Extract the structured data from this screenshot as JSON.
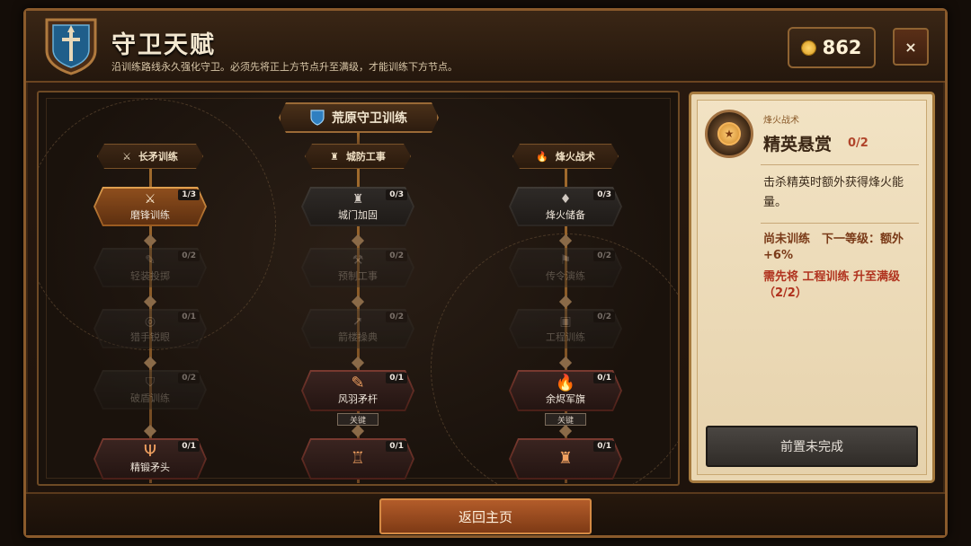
{
  "header": {
    "title": "守卫天赋",
    "subtitle": "沿训练路线永久强化守卫。必须先将正上方节点升至满级，才能训练下方节点。",
    "gold": "862",
    "close_label": "×"
  },
  "tree": {
    "title": "荒原守卫训练",
    "columns": [
      {
        "name": "长矛训练",
        "icon": "crossed-swords-icon",
        "nodes": [
          {
            "label": "磨锋训练",
            "count": "1/3",
            "icon": "crossed-swords-icon",
            "state": "active"
          },
          {
            "label": "轻装投掷",
            "count": "0/2",
            "icon": "feather-icon",
            "state": "locked"
          },
          {
            "label": "猎手锐眼",
            "count": "0/1",
            "icon": "target-icon",
            "state": "locked"
          },
          {
            "label": "破盾训练",
            "count": "0/2",
            "icon": "shield-icon",
            "state": "locked"
          },
          {
            "label": "精锻矛头",
            "count": "0/1",
            "icon": "trident-icon",
            "state": "key"
          }
        ]
      },
      {
        "name": "城防工事",
        "icon": "castle-icon",
        "nodes": [
          {
            "label": "城门加固",
            "count": "0/3",
            "icon": "castle-icon",
            "state": "available"
          },
          {
            "label": "预制工事",
            "count": "0/2",
            "icon": "hammer-icon",
            "state": "locked"
          },
          {
            "label": "箭楼操典",
            "count": "0/2",
            "icon": "arrow-icon",
            "state": "locked"
          },
          {
            "label": "风羽矛杆",
            "count": "0/1",
            "icon": "feather-icon",
            "state": "key",
            "tag": "关键"
          },
          {
            "label": "",
            "count": "0/1",
            "icon": "tower-icon",
            "state": "key"
          }
        ]
      },
      {
        "name": "烽火战术",
        "icon": "flame-icon",
        "nodes": [
          {
            "label": "烽火储备",
            "count": "0/3",
            "icon": "drop-icon",
            "state": "available"
          },
          {
            "label": "传令演练",
            "count": "0/2",
            "icon": "flag-icon",
            "state": "locked"
          },
          {
            "label": "工程训练",
            "count": "0/2",
            "icon": "chest-icon",
            "state": "locked"
          },
          {
            "label": "余烬军旗",
            "count": "0/1",
            "icon": "flame-icon",
            "state": "key",
            "tag": "关键"
          },
          {
            "label": "",
            "count": "0/1",
            "icon": "castle-icon",
            "state": "key"
          }
        ]
      }
    ]
  },
  "detail": {
    "category": "烽火战术",
    "name": "精英悬赏",
    "rank": "0/2",
    "description": "击杀精英时额外获得烽火能量。",
    "status": "尚未训练　下一等级：额外+6%",
    "requirement": "需先将 工程训练 升至满级（2/2）",
    "button": "前置未完成",
    "icon": "medal-icon"
  },
  "footer": {
    "home_button": "返回主页"
  },
  "colors": {
    "accent": "#a67a3e",
    "active_node": "#e0a050",
    "warning": "#b0321e"
  }
}
